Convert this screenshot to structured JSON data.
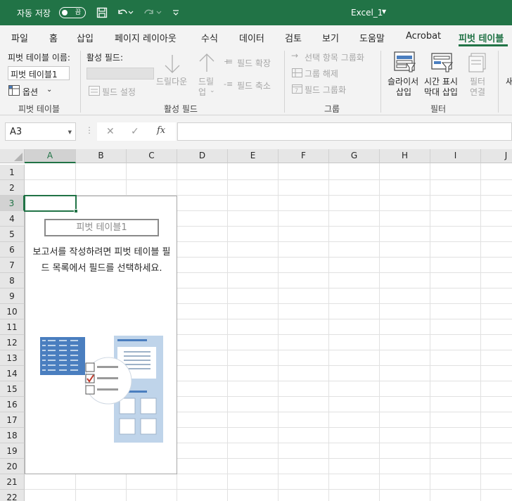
{
  "titlebar": {
    "autosave_label": "자동 저장",
    "autosave_state": "끔",
    "file_title": "Excel_1"
  },
  "tabs": [
    {
      "label": "파일"
    },
    {
      "label": "홈"
    },
    {
      "label": "삽입"
    },
    {
      "label": "페이지 레이아웃"
    },
    {
      "label": "수식"
    },
    {
      "label": "데이터"
    },
    {
      "label": "검토"
    },
    {
      "label": "보기"
    },
    {
      "label": "도움말"
    },
    {
      "label": "Acrobat"
    },
    {
      "label": "피벗 테이블"
    }
  ],
  "ribbon": {
    "pivot_table": {
      "name_label": "피벗 테이블 이름:",
      "name_value": "피벗 테이블1",
      "options_label": "옵션",
      "group_label": "피벗 테이블"
    },
    "active_field": {
      "label": "활성 필드:",
      "field_settings": "필드 설정",
      "drilldown": "드릴다운",
      "drillup_1": "드릴",
      "drillup_2": "업",
      "expand_field": "필드 확장",
      "collapse_field": "필드 축소",
      "group_label": "활성 필드"
    },
    "group": {
      "group_selection": "선택 항목 그룹화",
      "ungroup": "그룹 해제",
      "group_field": "필드 그룹화",
      "group_label": "그룹"
    },
    "filter": {
      "slicer_1": "슬라이서",
      "slicer_2": "삽입",
      "timeline_1": "시간 표시",
      "timeline_2": "막대 삽입",
      "connections_1": "필터",
      "connections_2": "연결",
      "group_label": "필터",
      "partial_next": "새"
    }
  },
  "formula_bar": {
    "name_box": "A3",
    "fx": "fx",
    "formula": ""
  },
  "grid": {
    "columns": [
      "A",
      "B",
      "C",
      "D",
      "E",
      "F",
      "G",
      "H",
      "I",
      "J"
    ],
    "rows": [
      "1",
      "2",
      "3",
      "4",
      "5",
      "6",
      "7",
      "8",
      "9",
      "10",
      "11",
      "12",
      "13",
      "14",
      "15",
      "16",
      "17",
      "18",
      "19",
      "20",
      "21",
      "22"
    ]
  },
  "pivot_placeholder": {
    "name": "피벗 테이블1",
    "message": "보고서를 작성하려면 피벗 테이블 필드 목록에서 필드를 선택하세요."
  },
  "colors": {
    "accent": "#217346",
    "ribbon_bg": "#f3f3f3",
    "illustration_blue": "#4a7ebf",
    "illustration_light": "#bfd4ea",
    "check_red": "#c0392b"
  }
}
